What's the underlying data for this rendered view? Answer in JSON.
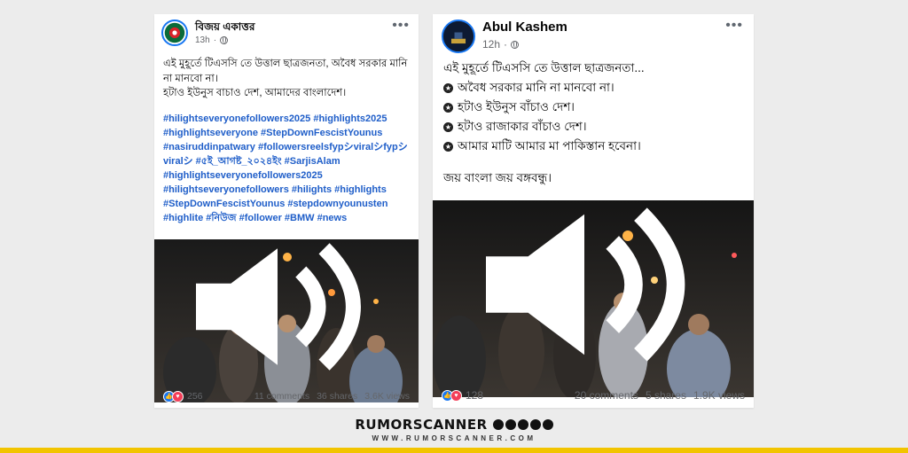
{
  "posts": [
    {
      "author": "বিজয় একাত্তর",
      "time": "13h",
      "text": "এই মুহূর্তে টিএসসি তে উত্তাল ছাত্রজনতা, অবৈধ সরকার মানি না মানবো না।\nহটাও ইউনুস বাচাও দেশ, আমাদের বাংলাদেশ।",
      "hashtags": "#hilightseveryonefollowers2025 #highlights2025 #highlightseveryone #StepDownFescistYounus #nasiruddinpatwary #followersreelsfypシviralシfypシviralシ #৫ই_আগষ্ট_২০২৪ইং #SarjisAlam #highlightseveryonefollowers2025 #hilightseveryonefollowers #hilights #highlights #StepDownFescistYounus #stepdownyounusten #highlite #নিউজ #follower #BMW #news",
      "reactions": "256",
      "comments": "11 comments",
      "shares": "36 shares",
      "views": "3.6K views"
    },
    {
      "author": "Abul Kashem",
      "time": "12h",
      "intro": "এই মুহূর্তে টিএসসি তে উত্তাল ছাত্রজনতা...",
      "bullets": [
        "অবৈধ সরকার মানি না মানবো না।",
        "হটাও ইউনুস বাঁচাও দেশ।",
        "হটাও রাজাকার বাঁচাও দেশ।",
        "আমার মাটি আমার মা পাকিস্তান হবেনা।"
      ],
      "closing": "জয় বাংলা জয় বঙ্গবন্ধু।",
      "reactions": "128",
      "comments": "20 comments",
      "shares": "5 shares",
      "views": "1.9K views"
    }
  ],
  "brand": {
    "name": "RUMORSCANNER",
    "url": "WWW.RUMORSCANNER.COM"
  },
  "colors": {
    "accent_yellow": "#f2c400",
    "hashtag_blue": "#1f5ec9",
    "fb_blue": "#1877f2"
  }
}
